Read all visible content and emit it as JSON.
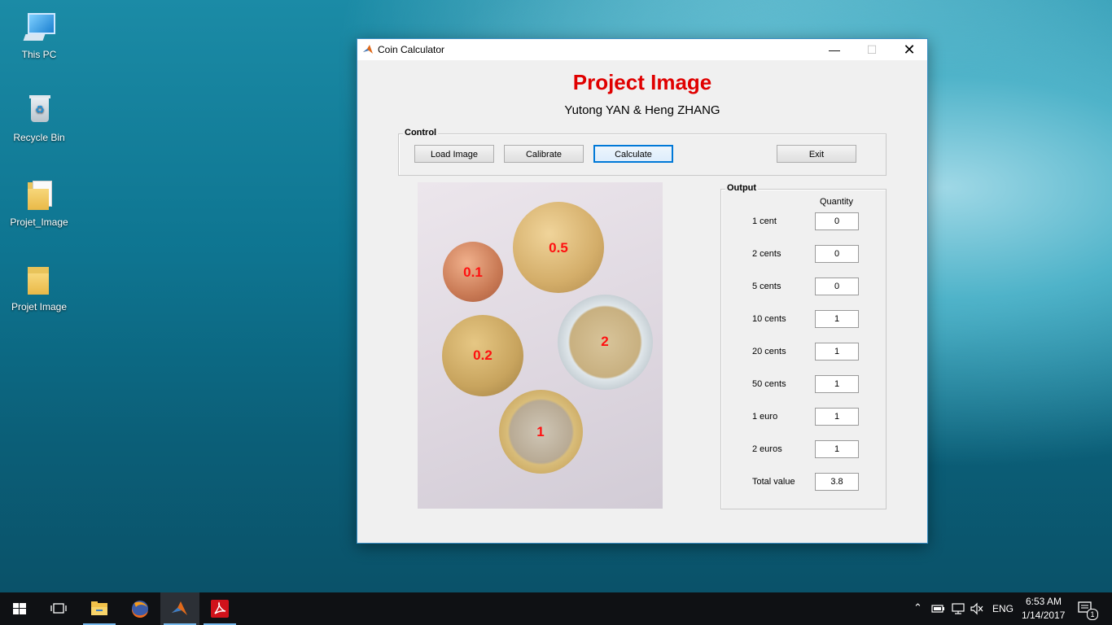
{
  "desktop": {
    "icons": [
      {
        "label": "This PC",
        "icon": "computer-icon"
      },
      {
        "label": "Recycle Bin",
        "icon": "recycle-bin-icon"
      },
      {
        "label": "Projet_Image",
        "icon": "folder-icon"
      },
      {
        "label": "Projet Image",
        "icon": "folder-icon"
      }
    ]
  },
  "window": {
    "title": "Coin Calculator",
    "heading": "Project Image",
    "subheading": "Yutong YAN & Heng ZHANG",
    "heading_color": "#e00000",
    "control": {
      "legend": "Control",
      "load_label": "Load Image",
      "calibrate_label": "Calibrate",
      "calculate_label": "Calculate",
      "exit_label": "Exit"
    },
    "coins": [
      {
        "label": "0.1"
      },
      {
        "label": "0.5"
      },
      {
        "label": "0.2"
      },
      {
        "label": "2"
      },
      {
        "label": "1"
      }
    ],
    "output": {
      "legend": "Output",
      "quantity_header": "Quantity",
      "rows": [
        {
          "label": "1 cent",
          "value": "0"
        },
        {
          "label": "2 cents",
          "value": "0"
        },
        {
          "label": "5 cents",
          "value": "0"
        },
        {
          "label": "10 cents",
          "value": "1"
        },
        {
          "label": "20 cents",
          "value": "1"
        },
        {
          "label": "50 cents",
          "value": "1"
        },
        {
          "label": "1 euro",
          "value": "1"
        },
        {
          "label": "2 euros",
          "value": "1"
        },
        {
          "label": "Total value",
          "value": "3.8"
        }
      ]
    }
  },
  "taskbar": {
    "language": "ENG",
    "time": "6:53 AM",
    "date": "1/14/2017",
    "notification_count": "1"
  }
}
